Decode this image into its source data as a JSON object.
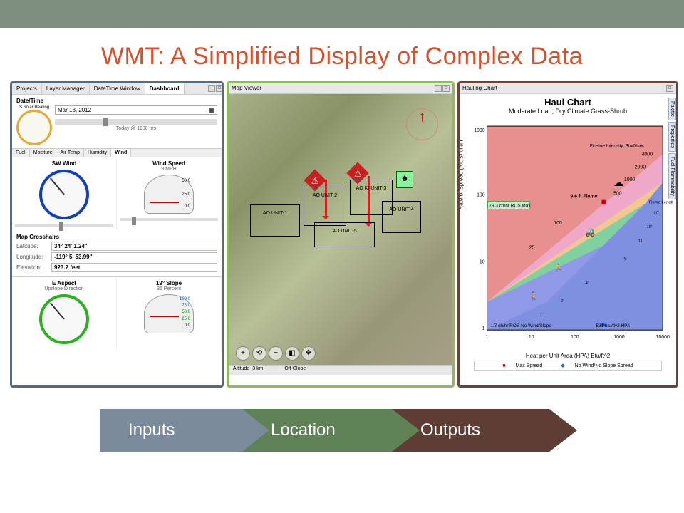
{
  "title": "WMT: A Simplified Display of Complex Data",
  "chevrons": [
    "Inputs",
    "Location",
    "Outputs"
  ],
  "inputs_panel": {
    "tabs": [
      "Projects",
      "Layer Manager",
      "DateTime Window",
      "Dashboard"
    ],
    "active_tab": "Dashboard",
    "datetime": {
      "section": "Date/Time",
      "solar_label": "S Solar Heating",
      "date": "Mar 13, 2012",
      "time_label": "Today @ 1100 hrs"
    },
    "wx_tabs": [
      "Fuel",
      "Moisture",
      "Air Temp",
      "Humidity",
      "Wind"
    ],
    "wx_active": "Wind",
    "wind": {
      "dir_label": "SW Wind",
      "speed_label": "Wind Speed",
      "speed_val": "9 MPH",
      "ticks": [
        "50.0",
        "25.0",
        "0.0"
      ]
    },
    "crosshairs": {
      "section": "Map Crosshairs",
      "lat_label": "Latitude:",
      "lat": "34° 24' 1.24\"",
      "lon_label": "Longitude:",
      "lon": "-119°  5' 53.99\"",
      "elev_label": "Elevation:",
      "elev": "923.2 feet"
    },
    "aspect": {
      "label": "E Aspect",
      "sub": "Upslope Direction",
      "slope_label": "19° Slope",
      "slope_sub": "35 Percent",
      "ticks": [
        "100.0",
        "75.0",
        "50.0",
        "25.0",
        "0.0"
      ]
    }
  },
  "map_panel": {
    "title": "Map Viewer",
    "units": [
      "AO UNIT-1",
      "AO UNIT-2",
      "AO KI UNIT-3",
      "AO UNIT-4",
      "AO UNIT-5"
    ],
    "footer_alt": "Altitude",
    "footer_dist": "3 km",
    "footer_globe": "Off Globe"
  },
  "chart_panel": {
    "tab": "Hauling Chart",
    "title": "Haul Chart",
    "subtitle": "Moderate Load, Dry Climate Grass-Shrub",
    "ylabel": "Rate of Spread (ROS) ch/hr",
    "xlabel": "Heat per Unit Area (HPA) Btu/ft^2",
    "legend_max": "Max Spread",
    "legend_nowind": "No Wind/No Slope Spread",
    "annotations": {
      "fli_header": "Fireline Intensity, Btu/ft/sec",
      "flame_header": "Flame Length, ft",
      "max_point": "9.6 ft Flame",
      "ros_max": "79.3 ch/hr ROS Max",
      "ros_nowind": "1.7 ch/hr ROS-No Wind/Slope",
      "hpa_val": "531 btu/ft^2 HPA"
    },
    "side_tabs": [
      "Palette",
      "Properties",
      "Fuel Flammability"
    ]
  },
  "chart_data": {
    "type": "scatter",
    "title": "Haul Chart — Moderate Load, Dry Climate Grass-Shrub",
    "xlabel": "Heat per Unit Area (HPA) Btu/ft^2",
    "ylabel": "Rate of Spread (ROS) ch/hr",
    "x_scale": "log",
    "y_scale": "log",
    "xlim": [
      1,
      10000
    ],
    "ylim": [
      1,
      1000
    ],
    "x_ticks": [
      1,
      10,
      100,
      1000,
      10000
    ],
    "y_ticks": [
      1,
      10,
      100,
      1000
    ],
    "diagonal_bands_fireline_intensity_btuftsec": [
      4000,
      2000,
      1000,
      500,
      100,
      25
    ],
    "flame_length_ft_contours": [
      20,
      15,
      11,
      8,
      4,
      2,
      1
    ],
    "series": [
      {
        "name": "Max Spread",
        "marker": "red-square",
        "x": [
          531
        ],
        "y": [
          79.3
        ],
        "flame_length_ft": 9.6
      },
      {
        "name": "No Wind/No Slope Spread",
        "marker": "blue-diamond",
        "x": [
          531
        ],
        "y": [
          1.7
        ]
      }
    ]
  }
}
